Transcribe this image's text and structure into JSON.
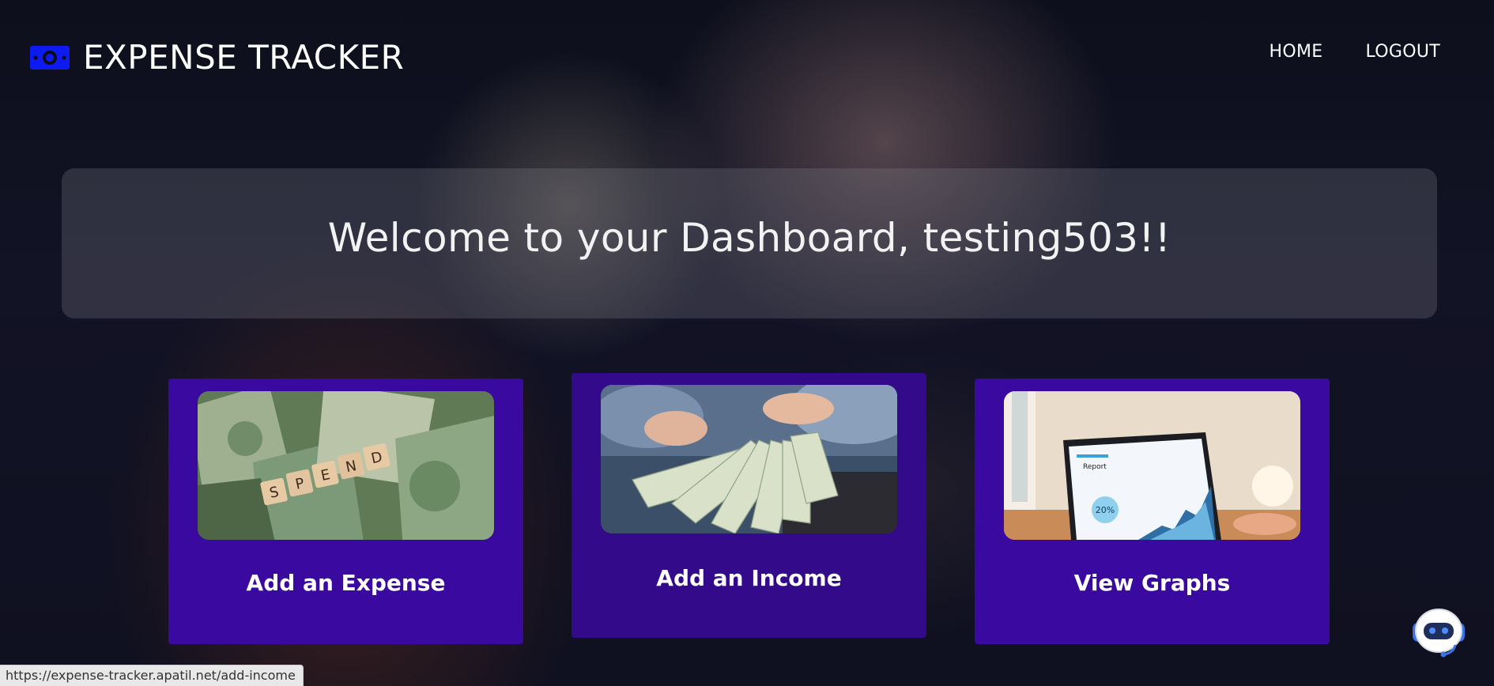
{
  "brand": {
    "name": "EXPENSE TRACKER",
    "icon": "money-bill-icon",
    "icon_color": "#0d1bf0"
  },
  "nav": {
    "home": "HOME",
    "logout": "LOGOUT"
  },
  "welcome": {
    "text": "Welcome to your Dashboard, testing503!!"
  },
  "cards": [
    {
      "title": "Add an Expense",
      "image": "spend-money-photo"
    },
    {
      "title": "Add an Income",
      "image": "hands-counting-cash-photo"
    },
    {
      "title": "View Graphs",
      "image": "laptop-graph-photo"
    }
  ],
  "chatbot": {
    "icon": "robot-chatbot-icon"
  },
  "status_bar": {
    "url": "https://expense-tracker.apatil.net/add-income"
  },
  "colors": {
    "card": "#3a0aa0",
    "card_hover": "#330a8a",
    "text": "#ffffff"
  }
}
